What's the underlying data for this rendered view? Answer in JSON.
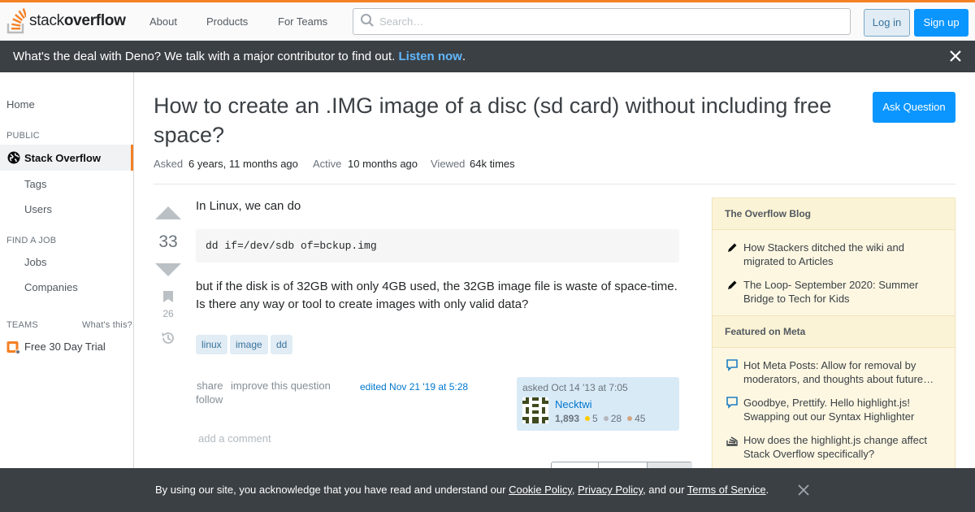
{
  "topbar": {
    "logo_text_light": "stack",
    "logo_text_bold": "overflow",
    "nav": [
      "About",
      "Products",
      "For Teams"
    ],
    "search_placeholder": "Search…",
    "login_label": "Log in",
    "signup_label": "Sign up",
    "accent_color": "#f48024"
  },
  "announcement": {
    "text": "What's the deal with Deno? We talk with a major contributor to find out.",
    "link": "Listen now",
    "suffix": "."
  },
  "leftnav": {
    "home": "Home",
    "public_header": "PUBLIC",
    "stack_overflow": "Stack Overflow",
    "tags": "Tags",
    "users": "Users",
    "find_job_header": "FIND A JOB",
    "jobs": "Jobs",
    "companies": "Companies",
    "teams_header": "TEAMS",
    "whats_this": "What's this?",
    "free_trial": "Free 30 Day Trial"
  },
  "question": {
    "title": "How to create an .IMG image of a disc (sd card) without including free space?",
    "ask_button": "Ask Question",
    "asked_label": "Asked",
    "asked_value": "6 years, 11 months ago",
    "active_label": "Active",
    "active_value": "10 months ago",
    "viewed_label": "Viewed",
    "viewed_value": "64k times",
    "votes": "33",
    "bookmarks": "26",
    "body_line1": "In Linux, we can do",
    "code": "dd if=/dev/sdb of=bckup.img",
    "body_line2": "but if the disk is of 32GB with only 4GB used, the 32GB image file is waste of space-time.",
    "body_line3": "Is there any way or tool to create images with only valid data?",
    "tags": [
      "linux",
      "image",
      "dd"
    ],
    "share": "share",
    "improve": "improve this question",
    "follow": "follow",
    "edited": "edited Nov 21 '19 at 5:28",
    "add_comment": "add a comment"
  },
  "owner": {
    "asked": "asked Oct 14 '13 at 7:05",
    "name": "Necktwi",
    "reputation": "1,893",
    "gold": "5",
    "silver": "28",
    "bronze": "45"
  },
  "sidebar": {
    "blog_header": "The Overflow Blog",
    "blog_items": [
      "How Stackers ditched the wiki and migrated to Articles",
      "The Loop- September 2020: Summer Bridge to Tech for Kids"
    ],
    "meta_header": "Featured on Meta",
    "meta_items": [
      "Hot Meta Posts: Allow for removal by moderators, and thoughts about future…",
      "Goodbye, Prettify. Hello highlight.js! Swapping out our Syntax Highlighter",
      "How does the highlight.js change affect Stack Overflow specifically?"
    ]
  },
  "cookie": {
    "prefix": "By using our site, you acknowledge that you have read and understand our",
    "cookie_policy": "Cookie Policy",
    "comma": ",",
    "privacy_policy": "Privacy Policy",
    "and_our": ", and our",
    "terms": "Terms of Service",
    "period": "."
  }
}
